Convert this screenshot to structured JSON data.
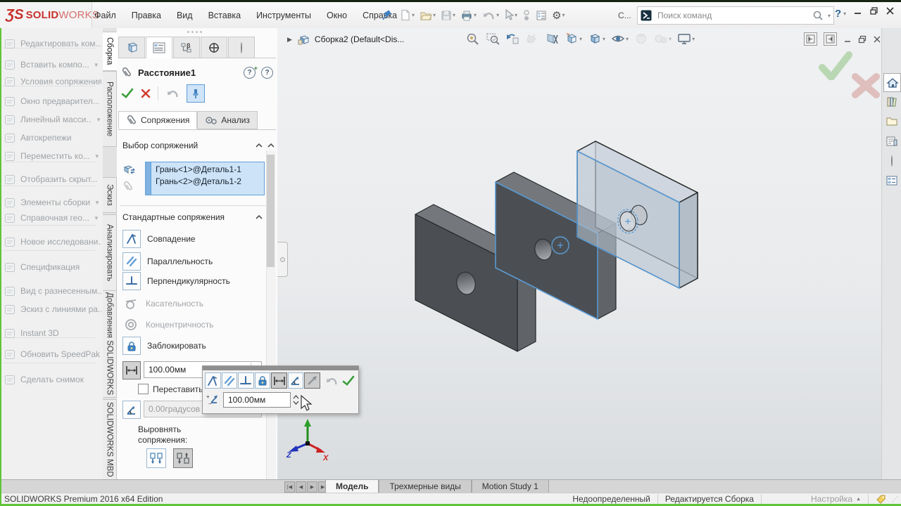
{
  "window": {
    "logo_glyph": "ƷS",
    "brand_bold": "SOLID",
    "brand_rest": "WORKS",
    "menu": [
      "Файл",
      "Правка",
      "Вид",
      "Вставка",
      "Инструменты",
      "Окно",
      "Справка"
    ],
    "quick_icons": [
      {
        "icon": "new-document-icon",
        "caret": true
      },
      {
        "icon": "open-document-icon",
        "caret": true
      },
      {
        "icon": "save-icon",
        "caret": true
      },
      {
        "icon": "print-icon",
        "caret": true
      },
      {
        "icon": "undo-icon",
        "caret": true
      },
      {
        "icon": "select-cursor-icon",
        "caret": true
      },
      {
        "icon": "selection-toggle-icon",
        "caret": false
      },
      {
        "icon": "document-properties-icon",
        "caret": false
      },
      {
        "icon": "options-gear-icon",
        "caret": true
      }
    ],
    "more_label": "С...",
    "search_placeholder": "Поиск команд",
    "help_label": "?"
  },
  "sidebar": {
    "items": [
      {
        "icon": "edit-component-icon",
        "label": "Редактировать ком...",
        "caret": false
      },
      {
        "icon": "insert-component-icon",
        "label": "Вставить компо...",
        "caret": true
      },
      {
        "icon": "mate-conditions-icon",
        "label": "Условия сопряжения",
        "caret": false
      },
      {
        "icon": "preview-window-icon",
        "label": "Окно предварител...",
        "caret": false
      },
      {
        "icon": "linear-pattern-icon",
        "label": "Линейный масси...",
        "caret": true
      },
      {
        "icon": "smart-fasteners-icon",
        "label": "Автокрепежи",
        "caret": false
      },
      {
        "icon": "move-component-icon",
        "label": "Переместить ко...",
        "caret": true
      },
      {
        "icon": "show-hidden-icon",
        "label": "Отобразить скрыт...",
        "caret": false
      },
      {
        "icon": "assembly-features-icon",
        "label": "Элементы сборки",
        "caret": true
      },
      {
        "icon": "reference-geometry-icon",
        "label": "Справочная гео...",
        "caret": true
      },
      {
        "icon": "new-motion-study-icon",
        "label": "Новое исследовани...",
        "caret": false
      },
      {
        "icon": "bom-icon",
        "label": "Спецификация",
        "caret": false
      },
      {
        "icon": "exploded-view-icon",
        "label": "Вид с разнесенным...",
        "caret": false
      },
      {
        "icon": "explode-line-sketch-icon",
        "label": "Эскиз с линиями ра...",
        "caret": false
      },
      {
        "icon": "instant3d-icon",
        "label": "Instant 3D",
        "caret": false
      },
      {
        "icon": "update-speedpak-icon",
        "label": "Обновить SpeedPak",
        "caret": false
      },
      {
        "icon": "take-snapshot-icon",
        "label": "Сделать снимок",
        "caret": false
      }
    ],
    "tabs": [
      {
        "label": "Сборка",
        "active": true
      },
      {
        "label": "Расположение",
        "active": false
      },
      {
        "label": "Эскиз",
        "active": false
      },
      {
        "label": "Анализировать",
        "active": false
      },
      {
        "label": "Добавления SOLIDWORKS",
        "active": false
      },
      {
        "label": "SOLIDWORKS MBD",
        "active": false
      }
    ]
  },
  "property_panel": {
    "header_tabs": [
      "assembly-manager-icon",
      "property-manager-icon",
      "configuration-manager-icon",
      "dimxpert-manager-icon",
      "display-manager-icon"
    ],
    "title": "Расстояние1",
    "sub_tabs": [
      {
        "icon": "paperclip-icon",
        "label": "Сопряжения",
        "active": true
      },
      {
        "icon": "gears-icon",
        "label": "Анализ",
        "active": false
      }
    ],
    "selection_header": "Выбор сопряжений",
    "selections": [
      "Грань<1>@Деталь1-1",
      "Грань<2>@Деталь1-2"
    ],
    "standard_header": "Стандартные сопряжения",
    "mates": [
      {
        "icon": "coincident-icon",
        "label": "Совпадение",
        "enabled": true
      },
      {
        "icon": "parallel-icon",
        "label": "Параллельность",
        "enabled": true
      },
      {
        "icon": "perpendicular-icon",
        "label": "Перпендикулярность",
        "enabled": true
      },
      {
        "icon": "tangent-icon",
        "label": "Касательность",
        "enabled": false
      },
      {
        "icon": "concentric-icon",
        "label": "Концентричность",
        "enabled": false
      },
      {
        "icon": "lock-icon",
        "label": "Заблокировать",
        "enabled": true
      }
    ],
    "distance_value": "100.00мм",
    "flip_checkbox_label": "Переставить ра",
    "angle_value": "0.00градусов",
    "align_label_line1": "Выровнять",
    "align_label_line2": "сопряжения:"
  },
  "popup_toolbar": {
    "buttons": [
      {
        "icon": "coincident-icon",
        "pressed": false
      },
      {
        "icon": "parallel-icon",
        "pressed": false
      },
      {
        "icon": "perpendicular-icon",
        "pressed": false
      },
      {
        "icon": "lock-icon",
        "pressed": false
      },
      {
        "icon": "distance-icon",
        "pressed": true
      },
      {
        "icon": "angle-icon",
        "pressed": false
      },
      {
        "icon": "flip-direction-icon",
        "pressed": true
      }
    ],
    "value": "100.00мм"
  },
  "document_bar": {
    "title": "Сборка2  (Default<Dis..."
  },
  "view_toolbar": [
    {
      "icon": "zoom-fit-icon",
      "caret": false,
      "enabled": true
    },
    {
      "icon": "zoom-area-icon",
      "caret": false,
      "enabled": true
    },
    {
      "icon": "previous-view-icon",
      "caret": false,
      "enabled": true
    },
    {
      "icon": "section-view-icon",
      "caret": false,
      "enabled": false
    },
    {
      "icon": "view-setting-icon",
      "caret": false,
      "enabled": true
    },
    {
      "icon": "view-orientation-icon",
      "caret": true,
      "enabled": true
    },
    {
      "icon": "display-style-icon",
      "caret": true,
      "enabled": true
    },
    {
      "icon": "hide-show-items-icon",
      "caret": true,
      "enabled": true
    },
    {
      "icon": "edit-appearance-icon",
      "caret": false,
      "enabled": false
    },
    {
      "icon": "apply-scene-icon",
      "caret": true,
      "enabled": false
    },
    {
      "icon": "view-settings-icon",
      "caret": true,
      "enabled": true
    }
  ],
  "task_pane": [
    "home-icon",
    "design-library-icon",
    "file-explorer-icon",
    "view-palette-icon",
    "appearances-icon",
    "custom-properties-icon"
  ],
  "viewport": {
    "triad_x_label": "X",
    "triad_z_label": "Z"
  },
  "bottom_tabs": {
    "tabs": [
      {
        "label": "Модель",
        "active": true
      },
      {
        "label": "Трехмерные виды",
        "active": false
      },
      {
        "label": "Motion Study 1",
        "active": false
      }
    ]
  },
  "status_bar": {
    "left": "SOLIDWORKS Premium 2016 x64 Edition",
    "doc_state": "Недоопределенный",
    "edit_mode": "Редактируется Сборка",
    "customize": "Настройка"
  }
}
